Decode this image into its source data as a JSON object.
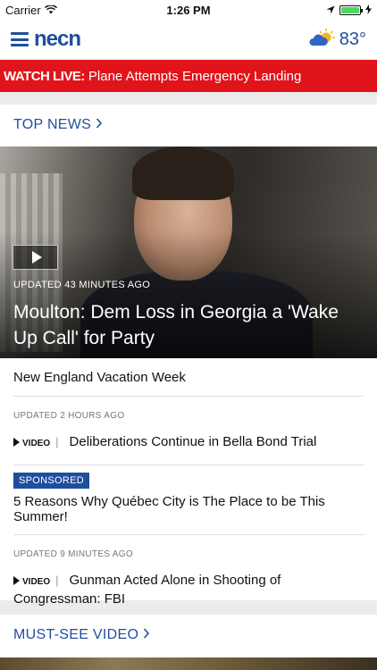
{
  "status": {
    "carrier": "Carrier",
    "time": "1:26 PM",
    "battery_level": 1.0
  },
  "header": {
    "logo": "necn",
    "temperature": "83°",
    "weather_icon": "partly-cloudy-icon"
  },
  "live": {
    "tag": "WATCH LIVE:",
    "text": "Plane Attempts Emergency Landing"
  },
  "top_news": {
    "title": "TOP NEWS",
    "hero": {
      "updated": "UPDATED 43 MINUTES AGO",
      "headline": "Moulton: Dem Loss in Georgia a 'Wake Up Call' for Party"
    },
    "stories": [
      {
        "text": "New England Vacation Week"
      },
      {
        "meta": "UPDATED 2 HOURS AGO",
        "tag": "VIDEO",
        "text": "Deliberations Continue in Bella Bond Trial"
      },
      {
        "badge": "SPONSORED",
        "text": "5 Reasons Why Québec City is The Place to be This Summer!"
      },
      {
        "meta": "UPDATED 9 MINUTES AGO",
        "tag": "VIDEO",
        "text": "Gunman Acted Alone in Shooting of Congressman: FBI"
      }
    ]
  },
  "must_see": {
    "title": "MUST-SEE VIDEO"
  },
  "colors": {
    "brand": "#1f4e9e",
    "live": "#e1141b",
    "battery": "#4cd964"
  }
}
